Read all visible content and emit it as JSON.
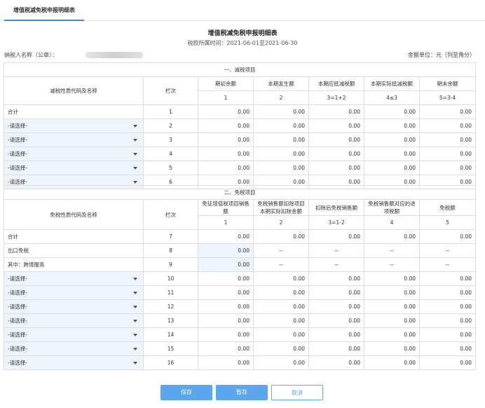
{
  "tab": {
    "label": "增值税减免税申报明细表"
  },
  "header": {
    "title": "增值税减免税申报明细表",
    "period": "税款所属时间：2021-06-01至2021-06-30",
    "taxpayer_label": "纳税人名称（公章）：",
    "unit": "金额单位：元（列至角分）"
  },
  "reduction": {
    "section_title": "一、减税项目",
    "col_name": "减税性质代码及名称",
    "col_line": "栏次",
    "columns": [
      "期初余额",
      "本期发生额",
      "本期应抵减税额",
      "本期实际抵减税额",
      "期末余额"
    ],
    "formulas": [
      "1",
      "2",
      "3=1+2",
      "4≤3",
      "5=3-4"
    ],
    "total": {
      "name": "合计",
      "line": "1",
      "values": [
        "0.00",
        "0.00",
        "0.00",
        "0.00",
        "0.00"
      ]
    },
    "rows": [
      {
        "placeholder": "-请选择-",
        "line": "2",
        "values": [
          "0.00",
          "0.00",
          "0.00",
          "0.00",
          "0.00"
        ]
      },
      {
        "placeholder": "-请选择-",
        "line": "3",
        "values": [
          "0.00",
          "0.00",
          "0.00",
          "0.00",
          "0.00"
        ]
      },
      {
        "placeholder": "-请选择-",
        "line": "4",
        "values": [
          "0.00",
          "0.00",
          "0.00",
          "0.00",
          "0.00"
        ]
      },
      {
        "placeholder": "-请选择-",
        "line": "5",
        "values": [
          "0.00",
          "0.00",
          "0.00",
          "0.00",
          "0.00"
        ]
      },
      {
        "placeholder": "-请选择-",
        "line": "6",
        "values": [
          "0.00",
          "0.00",
          "0.00",
          "0.00",
          "0.00"
        ]
      }
    ]
  },
  "exemption": {
    "section_title": "二、免税项目",
    "col_name": "免税性质代码及名称",
    "col_line": "栏次",
    "columns": [
      "免征增值税项目销售额",
      "免税销售额扣除项目本期实际扣除金额",
      "扣除后免税销售额",
      "免税销售额对应的进项税额",
      "免税额"
    ],
    "formulas": [
      "1",
      "2",
      "3=1-2",
      "4",
      "5"
    ],
    "total": {
      "name": "合计",
      "line": "7",
      "values": [
        "0.00",
        "0.00",
        "0.00",
        "0.00",
        "0.00"
      ]
    },
    "export": {
      "name": "出口免税",
      "line": "8",
      "value": "0.00",
      "dash": "--"
    },
    "cross_border": {
      "name": "其中：跨境服务",
      "line": "9",
      "value": "0.00",
      "dash": "--"
    },
    "rows": [
      {
        "placeholder": "-请选择-",
        "line": "10",
        "values": [
          "0.00",
          "0.00",
          "0.00",
          "0.00",
          "0.00"
        ]
      },
      {
        "placeholder": "-请选择-",
        "line": "11",
        "values": [
          "0.00",
          "0.00",
          "0.00",
          "0.00",
          "0.00"
        ]
      },
      {
        "placeholder": "-请选择-",
        "line": "12",
        "values": [
          "0.00",
          "0.00",
          "0.00",
          "0.00",
          "0.00"
        ]
      },
      {
        "placeholder": "-请选择-",
        "line": "13",
        "values": [
          "0.00",
          "0.00",
          "0.00",
          "0.00",
          "0.00"
        ]
      },
      {
        "placeholder": "-请选择-",
        "line": "14",
        "values": [
          "0.00",
          "0.00",
          "0.00",
          "0.00",
          "0.00"
        ]
      },
      {
        "placeholder": "-请选择-",
        "line": "15",
        "values": [
          "0.00",
          "0.00",
          "0.00",
          "0.00",
          "0.00"
        ]
      },
      {
        "placeholder": "-请选择-",
        "line": "16",
        "values": [
          "0.00",
          "0.00",
          "0.00",
          "0.00",
          "0.00"
        ]
      }
    ]
  },
  "buttons": {
    "save": "保存",
    "stage": "暂存",
    "cancel": "取消"
  },
  "colors": {
    "accent": "#5aa7ef",
    "highlight_bg": "#eef4fc",
    "link": "#3a8ee6"
  }
}
